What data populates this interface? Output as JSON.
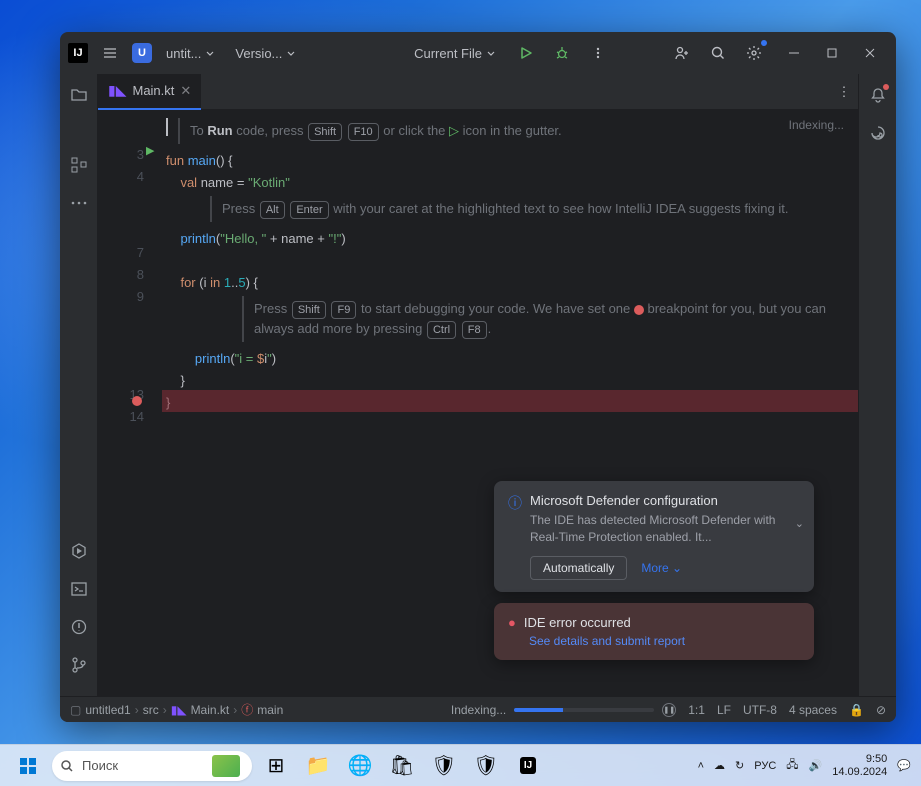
{
  "titlebar": {
    "project_initial": "U",
    "project_name": "untit...",
    "vcs": "Versio...",
    "run_config": "Current File"
  },
  "tab": {
    "filename": "Main.kt"
  },
  "editor": {
    "indexing": "Indexing...",
    "hint1_prefix": "To ",
    "hint1_run": "Run",
    "hint1_mid": " code, press ",
    "hint1_k1": "Shift",
    "hint1_k2": "F10",
    "hint1_suffix": " or click the ",
    "hint1_end": " icon in the gutter.",
    "hint2_prefix": "Press ",
    "hint2_k1": "Alt",
    "hint2_k2": "Enter",
    "hint2_body": " with your caret at the highlighted text to see how IntelliJ IDEA suggests fixing it.",
    "hint3_prefix": "Press ",
    "hint3_k1": "Shift",
    "hint3_k2": "F9",
    "hint3_mid": " to start debugging your code. We have set one ",
    "hint3_mid2": " breakpoint for you, but you can always add more by pressing ",
    "hint3_k3": "Ctrl",
    "hint3_k4": "F8",
    "lines": {
      "l3": "3",
      "l4": "4",
      "l7": "7",
      "l8": "8",
      "l9": "9",
      "l13": "13",
      "l14": "14"
    }
  },
  "notifications": {
    "defender": {
      "title": "Microsoft Defender configuration",
      "body": "The IDE has detected Microsoft Defender with Real-Time Protection enabled. It...",
      "automatically": "Automatically",
      "more": "More"
    },
    "error": {
      "title": "IDE error occurred",
      "link": "See details and submit report"
    }
  },
  "breadcrumb": {
    "project": "untitled1",
    "src": "src",
    "file": "Main.kt",
    "func": "main"
  },
  "status": {
    "indexing": "Indexing...",
    "pos": "1:1",
    "le": "LF",
    "enc": "UTF-8",
    "indent": "4 spaces"
  },
  "taskbar": {
    "search": "Поиск",
    "lang": "РУС",
    "time": "9:50",
    "date": "14.09.2024"
  }
}
